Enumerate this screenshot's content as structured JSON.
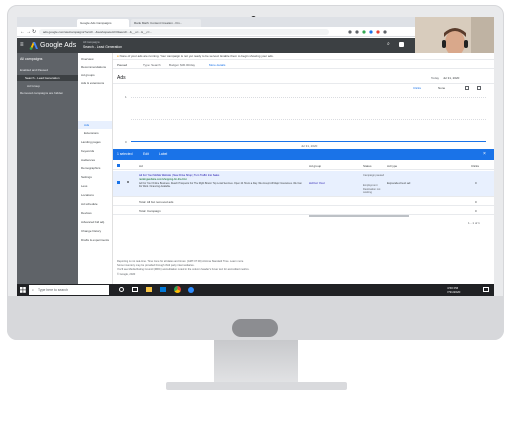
{
  "browser": {
    "tabs": [
      "Google Ads Campaigns",
      "Rank Math: Content Creation - Fin..."
    ],
    "url": "ads.google.com/aw/campaigns?ocid=...&workspaceId=0&euid=...&__u=...&__c=..."
  },
  "ads": {
    "product": "Google Ads",
    "account_line1": "All Campaigns",
    "account_line2": "Search - Lead Generation",
    "header_icons": [
      "search-icon",
      "reports-icon"
    ]
  },
  "sidebar": {
    "title": "All campaigns",
    "items": [
      {
        "label": "Enabled and Paused",
        "active": false
      },
      {
        "label": "Search - Lead Generation",
        "active": true
      },
      {
        "label": "Ad Group",
        "active": false
      },
      {
        "label": "Removed campaigns are hidden",
        "active": false
      }
    ]
  },
  "nav": {
    "items": [
      "Overview",
      "Recommendations",
      "Ad groups",
      "Ads & extensions",
      "Ads",
      "Extensions",
      "Landing pages",
      "Keywords",
      "Audiences",
      "Demographics",
      "Settings",
      "Less",
      "Locations",
      "Ad schedule",
      "Devices",
      "Advanced bid adj.",
      "Change history",
      "Drafts & experiments"
    ]
  },
  "main": {
    "notice": "None of your ads are running. Your campaign is not yet ready to be served. Enable them to begin showing your ads.",
    "filter_status": "Paused",
    "filter_type": "Type: Search",
    "filter_budget": "Budget: $30.00/day",
    "filter_more": "More details",
    "title": "Ads",
    "date_label": "Today",
    "date_value": "Jul 31, 2020",
    "metric1": "Clicks",
    "metric2": "None",
    "chart_axis_top": "1",
    "chart_axis_bottom": "0",
    "chart_date": "Jul 31, 2020",
    "selection": {
      "count": "1 selected",
      "edit": "Edit",
      "label": "Label"
    },
    "columns": {
      "ad": "Ad",
      "adgroup": "Ad group",
      "status": "Status",
      "adtype": "Ad type",
      "clicks": "Clicks"
    },
    "rows": [
      {
        "ad": "Ad For Your Mobile Website | New Drive Shop | Turn Traffic Into Sales",
        "ad_url": "rankingwebsite.com/shopping-for-the-first",
        "ad_desc": "Ad For Your Online Business. Reach Prospects For The Right Brand. Top Local Services. Open 24 Hours a Day. We Accept All Major Insurances. We Can Do Work. Financing Available.",
        "adgroup": "Ad For Your",
        "status": "Campaign paused",
        "status2": "Employment",
        "status3": "Destination not working",
        "adtype": "Expanded text ad",
        "clicks": "0"
      }
    ],
    "total_row1": "Total: All but removed ads",
    "total_row2": "Total: Campaign",
    "total_clicks1": "0",
    "total_clicks2": "0",
    "pagination": "1 - 1 of 1",
    "footer1": "Reporting is not real-time. Time zone for all dates and times: (GMT-07:00) Arizona Standard Time. Learn more",
    "footer2": "Some inventory may be provided through third party intermediaries.",
    "footer3": "You'll see Media Rating Council (MRC) accreditation noted in the column header's hover text for accredited metrics.",
    "copyright": "© Google, 2020"
  },
  "taskbar": {
    "search_placeholder": "Type here to search",
    "time": "4:50 PM",
    "date": "7/31/2020"
  },
  "colors": {
    "accent": "#1a73e8",
    "sidebar": "#5f6368",
    "header": "#3c4043",
    "warning": "#f29900"
  }
}
